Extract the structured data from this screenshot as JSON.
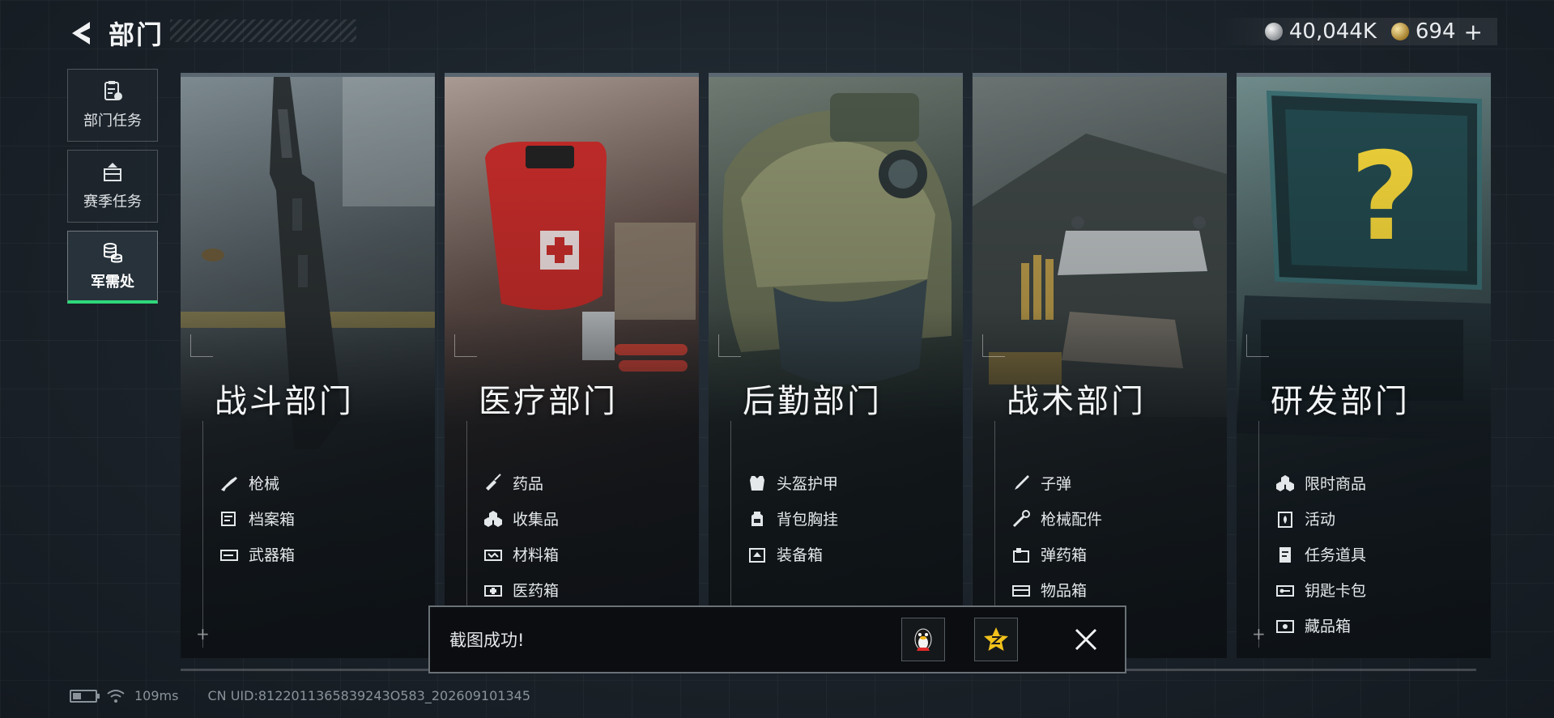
{
  "header": {
    "title": "部门",
    "back_icon": "back-arrow-icon"
  },
  "currency": {
    "silver_value": "40,044K",
    "gold_value": "694",
    "plus_label": "+"
  },
  "side_nav": {
    "items": [
      {
        "label": "部门任务",
        "icon": "task-clipboard-icon",
        "active": false
      },
      {
        "label": "赛季任务",
        "icon": "season-task-icon",
        "active": false
      },
      {
        "label": "军需处",
        "icon": "coin-stack-icon",
        "active": true
      }
    ]
  },
  "cards": [
    {
      "title": "战斗部门",
      "items": [
        {
          "label": "枪械",
          "icon": "rifle-icon"
        },
        {
          "label": "档案箱",
          "icon": "file-box-icon"
        },
        {
          "label": "武器箱",
          "icon": "weapon-case-icon"
        }
      ]
    },
    {
      "title": "医疗部门",
      "items": [
        {
          "label": "药品",
          "icon": "syringe-icon"
        },
        {
          "label": "收集品",
          "icon": "collectibles-icon"
        },
        {
          "label": "材料箱",
          "icon": "material-box-icon"
        },
        {
          "label": "医药箱",
          "icon": "medkit-icon"
        }
      ]
    },
    {
      "title": "后勤部门",
      "items": [
        {
          "label": "头盔护甲",
          "icon": "armor-icon"
        },
        {
          "label": "背包胸挂",
          "icon": "backpack-icon"
        },
        {
          "label": "装备箱",
          "icon": "equipment-box-icon"
        }
      ]
    },
    {
      "title": "战术部门",
      "items": [
        {
          "label": "子弹",
          "icon": "bullet-icon"
        },
        {
          "label": "枪械配件",
          "icon": "scope-icon"
        },
        {
          "label": "弹药箱",
          "icon": "ammo-box-icon"
        },
        {
          "label": "物品箱",
          "icon": "item-box-icon"
        }
      ]
    },
    {
      "title": "研发部门",
      "items": [
        {
          "label": "限时商品",
          "icon": "limited-goods-icon"
        },
        {
          "label": "活动",
          "icon": "event-icon"
        },
        {
          "label": "任务道具",
          "icon": "task-item-icon"
        },
        {
          "label": "钥匙卡包",
          "icon": "keycard-icon"
        },
        {
          "label": "藏品箱",
          "icon": "collection-box-icon"
        }
      ]
    }
  ],
  "toast": {
    "message": "截图成功!",
    "share_qq_icon": "qq-penguin-icon",
    "share_qzone_icon": "qzone-star-icon",
    "close_icon": "close-icon"
  },
  "footer": {
    "ping": "109ms",
    "uid": "CN UID:8122011365839243O583_202609101345",
    "battery_level": 0.4
  },
  "colors": {
    "active_accent": "#2fd87a",
    "background": "#1a2128",
    "qzone_accent": "#f2c21b"
  }
}
